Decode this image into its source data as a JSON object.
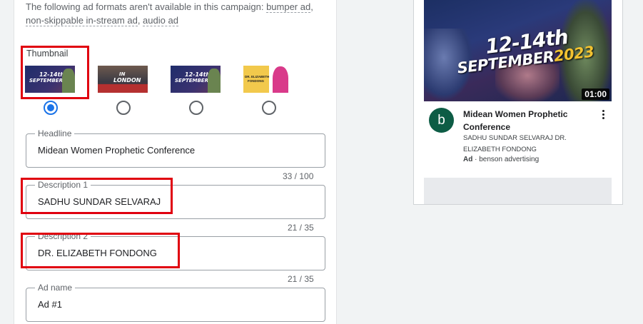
{
  "notice": {
    "text": "The following ad formats aren't available in this campaign: ",
    "links": [
      "bumper ad",
      "non-skippable in-stream ad",
      "audio ad"
    ],
    "sep": ", "
  },
  "thumbnail": {
    "label": "Thumbnail",
    "options": [
      {
        "name": "conference-thumb-1",
        "line1": "12-14th",
        "line2": "SEPTEMBER",
        "selected": true
      },
      {
        "name": "london-thumb",
        "line1": "IN",
        "line2": "LONDON",
        "selected": false
      },
      {
        "name": "conference-thumb-2",
        "line1": "12-14th",
        "line2": "SEPTEMBER",
        "selected": false
      },
      {
        "name": "speaker-thumb",
        "line1": "DR. ELIZABETH",
        "line2": "FONDONG",
        "selected": false
      }
    ]
  },
  "fields": {
    "headline": {
      "label": "Headline",
      "value": "Midean Women Prophetic Conference",
      "count": "33 / 100"
    },
    "description1": {
      "label": "Description 1",
      "value": "SADHU SUNDAR SELVARAJ",
      "count": "21 / 35"
    },
    "description2": {
      "label": "Description 2",
      "value": "DR. ELIZABETH FONDONG",
      "count": "21 / 35"
    },
    "ad_name": {
      "label": "Ad name",
      "value": "Ad #1"
    }
  },
  "preview": {
    "video_text_1": "12-14th",
    "video_text_2a": "SEPTEMBER",
    "video_text_2b": "2023",
    "duration": "01:00",
    "avatar_letter": "b",
    "title": "Midean Women Prophetic Conference",
    "description": "SADHU SUNDAR SELVARAJ DR. ELIZABETH FONDONG",
    "ad_badge": "Ad",
    "advertiser": " · benson advertising"
  },
  "colors": {
    "accent": "#1a73e8",
    "highlight": "#e0000f",
    "avatar": "#0d5c45"
  }
}
